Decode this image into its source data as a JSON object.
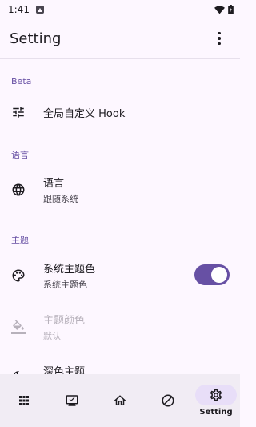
{
  "status_bar": {
    "time": "1:41"
  },
  "app_bar": {
    "title": "Setting"
  },
  "sections": {
    "beta": {
      "header": "Beta",
      "items": [
        {
          "title": "全局自定义 Hook",
          "icon": "tune-icon"
        }
      ]
    },
    "language": {
      "header": "语言",
      "items": [
        {
          "title": "语言",
          "subtitle": "跟随系统",
          "icon": "globe-icon"
        }
      ]
    },
    "theme": {
      "header": "主题",
      "items": [
        {
          "title": "系统主题色",
          "subtitle": "系统主题色",
          "icon": "palette-icon",
          "toggle": true
        },
        {
          "title": "主题颜色",
          "subtitle": "默认",
          "icon": "format-color-fill-icon",
          "disabled": true
        },
        {
          "title": "深色主题",
          "icon": "dark-mode-icon"
        }
      ]
    }
  },
  "bottom_nav": {
    "items": [
      {
        "name": "apps",
        "icon": "apps-grid-icon"
      },
      {
        "name": "hooks",
        "icon": "device-check-icon"
      },
      {
        "name": "home",
        "icon": "home-icon"
      },
      {
        "name": "blocked",
        "icon": "block-icon"
      },
      {
        "name": "setting",
        "label": "Setting",
        "icon": "gear-icon",
        "active": true
      }
    ]
  },
  "colors": {
    "accent": "#6750A4",
    "background": "#FDF7FF",
    "nav_background": "#F1ECF4",
    "nav_active_pill": "#E8DEF8"
  }
}
